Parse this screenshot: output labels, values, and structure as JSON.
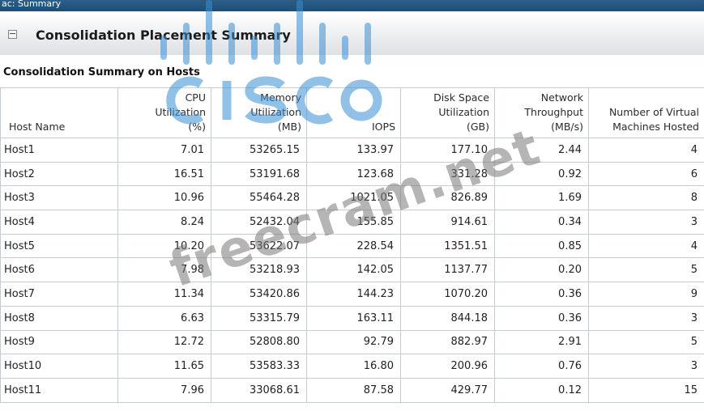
{
  "window": {
    "title": "ac: Summary"
  },
  "section": {
    "title": "Consolidation Placement Summary",
    "collapse_glyph": "⊟"
  },
  "subheading": "Consolidation Summary on Hosts",
  "table": {
    "headers": [
      [
        "Host Name"
      ],
      [
        "CPU",
        "Utilization",
        "(%)"
      ],
      [
        "Memory",
        "Utilization",
        "(MB)"
      ],
      [
        "IOPS"
      ],
      [
        "Disk Space",
        "Utilization",
        "(GB)"
      ],
      [
        "Network",
        "Throughput",
        "(MB/s)"
      ],
      [
        "Number of Virtual",
        "Machines Hosted"
      ]
    ],
    "rows": [
      [
        "Host1",
        "7.01",
        "53265.15",
        "133.97",
        "177.10",
        "2.44",
        "4"
      ],
      [
        "Host2",
        "16.51",
        "53191.68",
        "123.68",
        "331.28",
        "0.92",
        "6"
      ],
      [
        "Host3",
        "10.96",
        "55464.28",
        "1021.05",
        "826.89",
        "1.69",
        "8"
      ],
      [
        "Host4",
        "8.24",
        "52432.04",
        "155.85",
        "914.61",
        "0.34",
        "3"
      ],
      [
        "Host5",
        "10.20",
        "53622.07",
        "228.54",
        "1351.51",
        "0.85",
        "4"
      ],
      [
        "Host6",
        "7.98",
        "53218.93",
        "142.05",
        "1137.77",
        "0.20",
        "5"
      ],
      [
        "Host7",
        "11.34",
        "53420.86",
        "144.23",
        "1070.20",
        "0.36",
        "9"
      ],
      [
        "Host8",
        "6.63",
        "53315.79",
        "163.11",
        "844.18",
        "0.36",
        "3"
      ],
      [
        "Host9",
        "12.72",
        "52808.80",
        "92.79",
        "882.97",
        "2.91",
        "5"
      ],
      [
        "Host10",
        "11.65",
        "53583.33",
        "16.80",
        "200.96",
        "0.76",
        "3"
      ],
      [
        "Host11",
        "7.96",
        "33068.61",
        "87.58",
        "429.77",
        "0.12",
        "15"
      ]
    ]
  },
  "watermark": {
    "logo_text": "cisco",
    "site_text": "freecram.net",
    "logo_color": "#3a8fd4"
  }
}
